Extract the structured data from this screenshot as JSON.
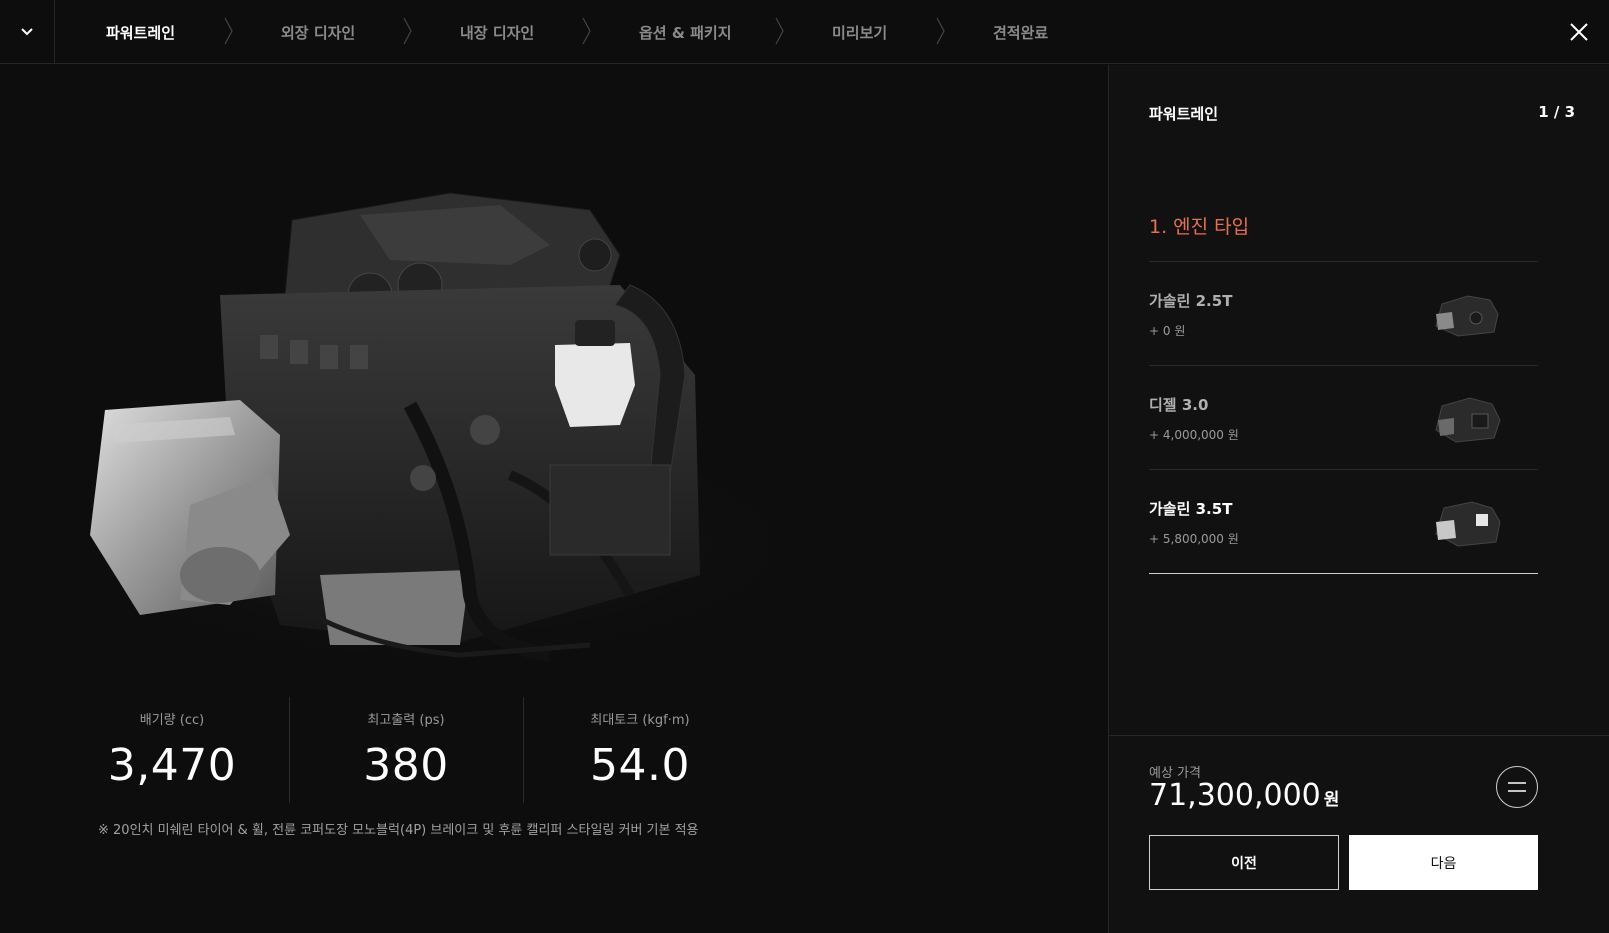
{
  "nav": {
    "steps": [
      {
        "label": "파워트레인",
        "active": true
      },
      {
        "label": "외장 디자인",
        "active": false
      },
      {
        "label": "내장 디자인",
        "active": false
      },
      {
        "label": "옵션 & 패키지",
        "active": false
      },
      {
        "label": "미리보기",
        "active": false
      },
      {
        "label": "견적완료",
        "active": false
      }
    ],
    "menu_icon": "chevron-down-icon",
    "close_icon": "close-icon"
  },
  "specs": [
    {
      "label": "배기량 (cc)",
      "value": "3,470"
    },
    {
      "label": "최고출력 (ps)",
      "value": "380"
    },
    {
      "label": "최대토크 (kgf·m)",
      "value": "54.0"
    }
  ],
  "note": "※ 20인치 미쉐린 타이어 & 휠, 전륜 코퍼도장 모노블럭(4P) 브레이크 및 후륜 캘리퍼 스타일링 커버 기본 적용",
  "panel": {
    "title": "파워트레인",
    "page": "1 / 3",
    "section_title": "1. 엔진 타입",
    "accent_color": "#e8704c",
    "options": [
      {
        "name": "가솔린 2.5T",
        "price": "+ 0 원",
        "selected": false
      },
      {
        "name": "디젤 3.0",
        "price": "+ 4,000,000 원",
        "selected": false
      },
      {
        "name": "가솔린 3.5T",
        "price": "+ 5,800,000 원",
        "selected": true
      }
    ]
  },
  "price": {
    "label": "예상 가격",
    "value": "71,300,000",
    "unit": "원",
    "summary_icon": "menu-lines-icon"
  },
  "buttons": {
    "prev": "이전",
    "next": "다음"
  }
}
